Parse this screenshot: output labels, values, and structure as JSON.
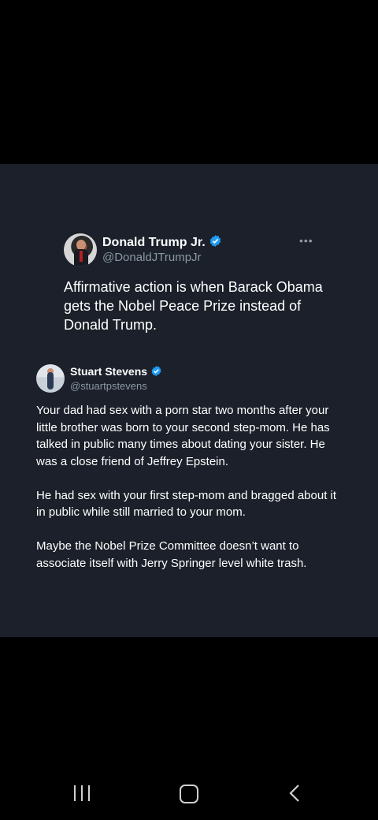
{
  "tweet": {
    "author_name": "Donald Trump Jr.",
    "author_handle": "@DonaldJTrumpJr",
    "more_label": "•••",
    "text": "Affirmative action is when Barack Obama gets the Nobel Peace Prize instead of Donald Trump."
  },
  "reply": {
    "author_name": "Stuart Stevens",
    "author_handle": "@stuartpstevens",
    "paragraphs": [
      "Your dad had sex with a porn star two months after your little brother was born to your second step-mom. He has talked in public many times about dating your sister. He was a close friend of Jeffrey Epstein.",
      "He had sex with your first step-mom and bragged about it in public while still married to your mom.",
      "Maybe the Nobel Prize Committee doesn’t want to associate itself with Jerry Springer level white trash."
    ]
  },
  "icons": {
    "verified": "verified-badge-icon",
    "recent_apps": "recent-apps-icon",
    "home": "home-icon",
    "back": "back-icon"
  },
  "colors": {
    "card_background": "#1b202a",
    "verified_blue": "#1d9bf0",
    "secondary_text": "#8b98a5"
  }
}
